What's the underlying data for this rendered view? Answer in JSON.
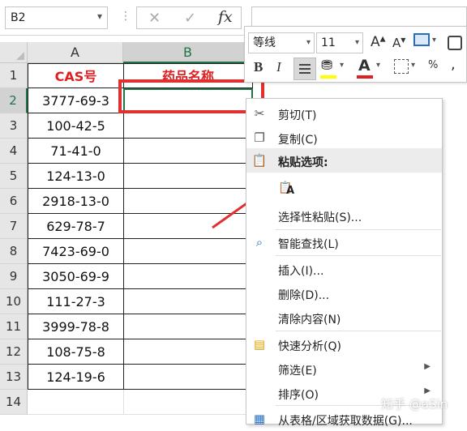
{
  "formula_bar": {
    "name_box": "B2",
    "cancel_icon": "close-icon",
    "enter_icon": "check-icon",
    "fx_label": "fx",
    "formula_value": ""
  },
  "columns": [
    "A",
    "B"
  ],
  "rows": [
    "1",
    "2",
    "3",
    "4",
    "5",
    "6",
    "7",
    "8",
    "9",
    "10",
    "11",
    "12",
    "13",
    "14"
  ],
  "cells": {
    "a1": "CAS号",
    "b1": "药品名称",
    "data": [
      "3777-69-3",
      "100-42-5",
      "71-41-0",
      "124-13-0",
      "2918-13-0",
      "629-78-7",
      "7423-69-0",
      "3050-69-9",
      "111-27-3",
      "3999-78-8",
      "108-75-8",
      "124-19-6"
    ]
  },
  "mini_toolbar": {
    "font_name": "等线",
    "font_size": "11",
    "increase_font": "A",
    "decrease_font": "A",
    "bold": "B",
    "italic": "I",
    "font_color_letter": "A",
    "percent": "%",
    "comma": ",",
    "fill_color": "#ffff00",
    "font_color": "#e02020"
  },
  "context_menu": {
    "cut": "剪切(T)",
    "copy": "复制(C)",
    "paste_options": "粘贴选项:",
    "paste_icon_letter": "A",
    "paste_special": "选择性粘贴(S)...",
    "smart_lookup": "智能查找(L)",
    "insert": "插入(I)...",
    "delete": "删除(D)...",
    "clear_contents": "清除内容(N)",
    "quick_analysis": "快速分析(Q)",
    "filter": "筛选(E)",
    "sort": "排序(O)",
    "get_data": "从表格/区域获取数据(G)..."
  },
  "watermark": "知乎 @aSin",
  "colors": {
    "accent_green": "#217346",
    "header_red": "#e02020",
    "highlight_box": "#e03030"
  }
}
